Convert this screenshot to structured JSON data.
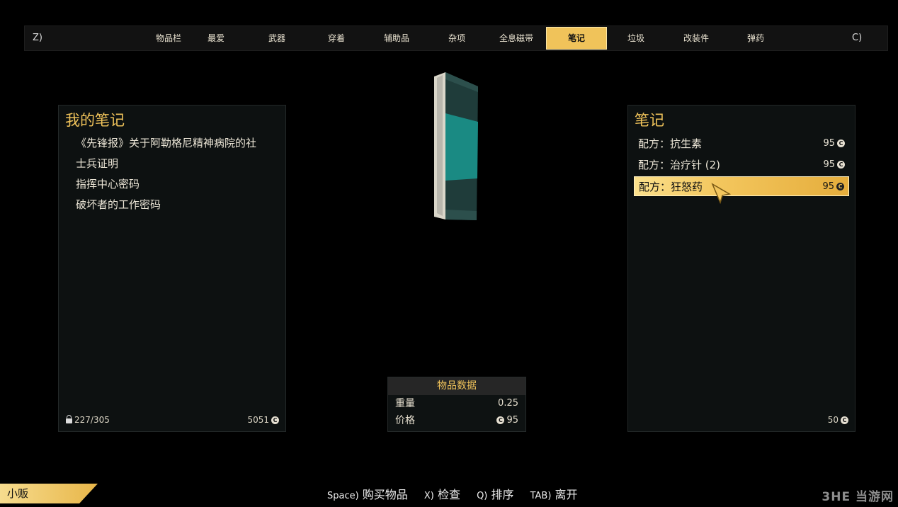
{
  "tabbar": {
    "prev_hotkey": "Z)",
    "next_hotkey": "C)",
    "tabs": [
      {
        "label": "物品栏"
      },
      {
        "label": "最爱"
      },
      {
        "label": "武器"
      },
      {
        "label": "穿着"
      },
      {
        "label": "辅助品"
      },
      {
        "label": "杂项"
      },
      {
        "label": "全息磁带"
      },
      {
        "label": "笔记",
        "active": true
      },
      {
        "label": "垃圾"
      },
      {
        "label": "改装件"
      },
      {
        "label": "弹药"
      }
    ]
  },
  "left_panel": {
    "title": "我的笔记",
    "items": [
      {
        "label": "《先锋报》关于阿勒格尼精神病院的社"
      },
      {
        "label": "士兵证明"
      },
      {
        "label": "指挥中心密码"
      },
      {
        "label": "破坏者的工作密码"
      }
    ],
    "carry_weight": "227/305",
    "caps": "5051"
  },
  "right_panel": {
    "title": "笔记",
    "items": [
      {
        "label": "配方：抗生素",
        "price": "95"
      },
      {
        "label": "配方：治疗针 (2)",
        "price": "95"
      },
      {
        "label": "配方：狂怒药",
        "price": "95",
        "selected": true
      }
    ],
    "caps": "50"
  },
  "item_stats": {
    "header": "物品数据",
    "rows": [
      {
        "label": "重量",
        "value": "0.25"
      },
      {
        "label": "价格",
        "value": "95"
      }
    ]
  },
  "vendor_tag": "小贩",
  "hints": [
    {
      "key": "Space)",
      "action": "购买物品"
    },
    {
      "key": "X)",
      "action": "检查"
    },
    {
      "key": "Q)",
      "action": "排序"
    },
    {
      "key": "TAB)",
      "action": "离开"
    }
  ],
  "watermark": "3HE 当游网",
  "caps_glyph": "C",
  "colors": {
    "accent": "#f0c35a",
    "panel_bg": "#0d1111",
    "text": "#e6dfcf"
  },
  "icons": [
    "lock-icon",
    "caps-icon",
    "pointer-cursor-icon",
    "note-book-model"
  ]
}
